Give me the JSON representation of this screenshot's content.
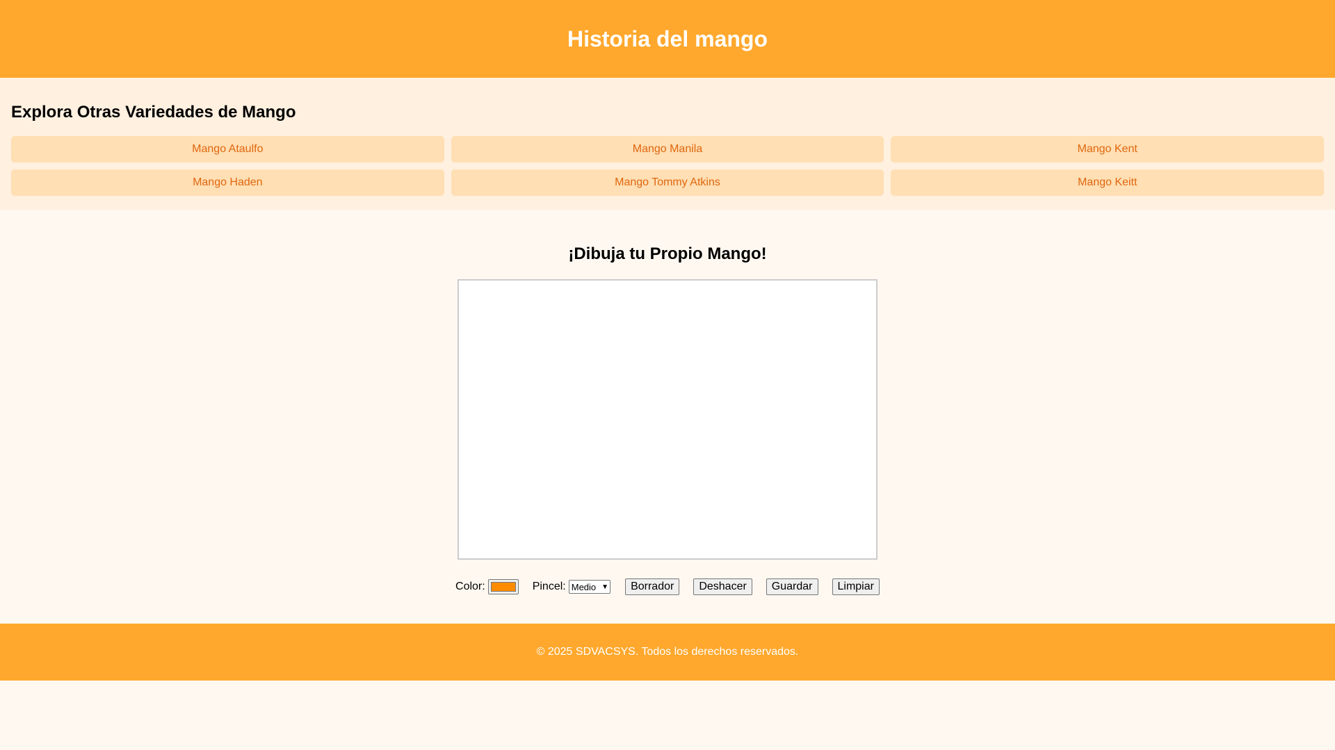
{
  "header": {
    "title": "Historia del mango"
  },
  "varieties": {
    "heading": "Explora Otras Variedades de Mango",
    "items": [
      {
        "label": "Mango Ataulfo"
      },
      {
        "label": "Mango Manila"
      },
      {
        "label": "Mango Kent"
      },
      {
        "label": "Mango Haden"
      },
      {
        "label": "Mango Tommy Atkins"
      },
      {
        "label": "Mango Keitt"
      }
    ]
  },
  "drawing": {
    "title": "¡Dibuja tu Propio Mango!",
    "controls": {
      "color_label": "Color:",
      "color_value": "#ff8c00",
      "brush_label": "Pincel:",
      "brush_selected": "Medio",
      "eraser_label": "Borrador",
      "undo_label": "Deshacer",
      "save_label": "Guardar",
      "clear_label": "Limpiar"
    }
  },
  "footer": {
    "text": "© 2025 SDVACSYS. Todos los derechos reservados."
  },
  "colors": {
    "header_bg": "#ffa82d",
    "section_bg": "#fff0e0",
    "link_bg": "#ffdfb3",
    "link_text": "#e0660f",
    "page_bg": "#fff8f1"
  }
}
